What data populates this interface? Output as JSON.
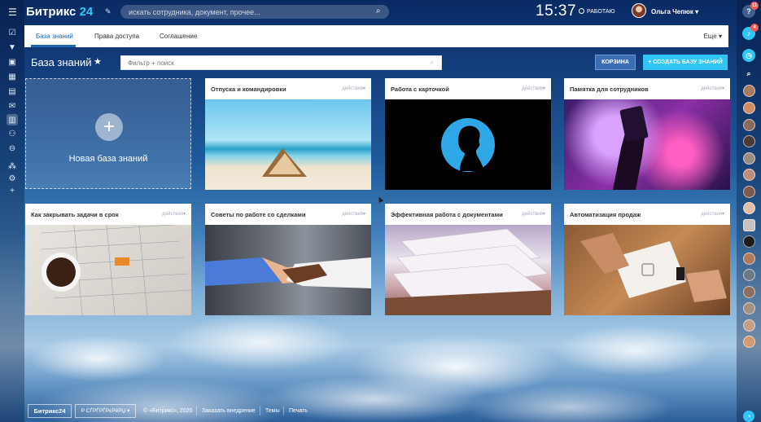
{
  "header": {
    "logo_text": "Битрикс",
    "logo_num": "24",
    "search_placeholder": "искать сотрудника, документ, прочее...",
    "clock": "15:37",
    "work_status": "РАБОТАЮ",
    "user_name": "Ольга Чепюк",
    "right_badge_help": "11",
    "right_badge_notify": "4"
  },
  "tabs": {
    "items": [
      "База знаний",
      "Права доступа",
      "Соглашение"
    ],
    "more": "Еще"
  },
  "page": {
    "title": "База знаний",
    "filter_placeholder": "Фильтр + поиск",
    "btn_trash": "КОРЗИНА",
    "btn_create": "СОЗДАТЬ БАЗУ ЗНАНИЙ",
    "new_card": "Новая база знаний"
  },
  "cards": [
    {
      "title": "Отпуска и командировки",
      "actions": "действия",
      "image": "beach-photo"
    },
    {
      "title": "Работа с карточкой",
      "actions": "действия",
      "image": "profile-silhouette"
    },
    {
      "title": "Памятка для сотрудников",
      "actions": "действия",
      "image": "concert-photo"
    },
    {
      "title": "Как закрывать задачи в срок",
      "actions": "действия",
      "image": "coffee-calendar-photo"
    },
    {
      "title": "Советы по работе со сделками",
      "actions": "действия",
      "image": "handshake-photo"
    },
    {
      "title": "Эффективная работа с документами",
      "actions": "действия",
      "image": "papers-photo"
    },
    {
      "title": "Автоматизация продаж",
      "actions": "действия",
      "image": "pos-terminal-photo"
    }
  ],
  "footer": {
    "logo": "Битрикс24",
    "lang": "Р СЃРЃРЃРєРёРЏ",
    "copyright": "© «Битрикс», 2020",
    "order": "Заказать внедрение",
    "themes": "Темы",
    "print": "Печать"
  },
  "colors": {
    "accent": "#2fc6f6",
    "tab_active": "#2067b0",
    "badge": "#ff5752"
  }
}
